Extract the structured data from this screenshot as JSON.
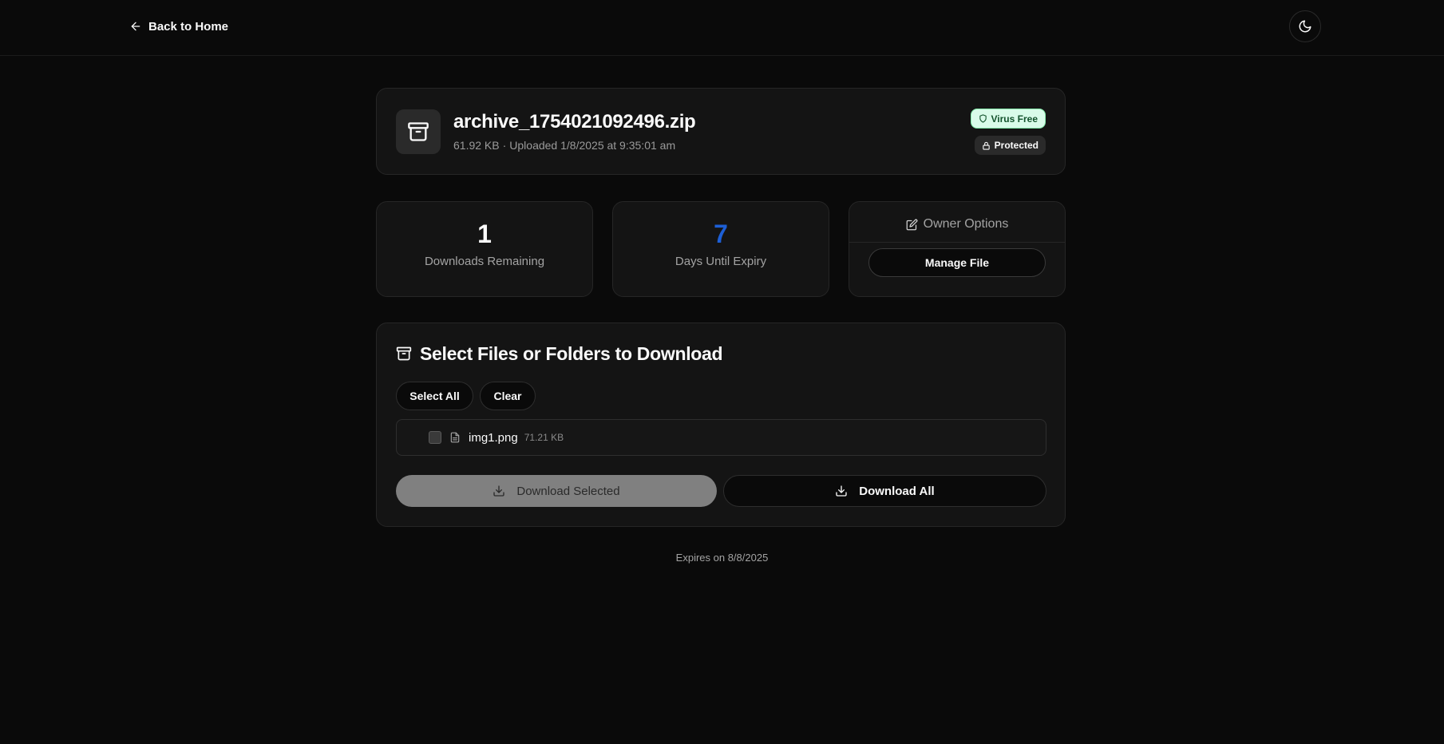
{
  "header": {
    "back_label": "Back to Home",
    "theme_icon": "moon-icon"
  },
  "file": {
    "name": "archive_1754021092496.zip",
    "size": "61.92 KB",
    "separator": "·",
    "uploaded": "Uploaded 1/8/2025 at 9:35:01 am",
    "icon": "archive-icon",
    "badges": {
      "virus_free": "Virus Free",
      "protected": "Protected"
    }
  },
  "stats": {
    "downloads_remaining_value": "1",
    "downloads_remaining_label": "Downloads Remaining",
    "days_until_expiry_value": "7",
    "days_until_expiry_label": "Days Until Expiry",
    "days_color": "#1d5fd6"
  },
  "owner": {
    "title": "Owner Options",
    "manage_label": "Manage File"
  },
  "selection": {
    "title": "Select Files or Folders to Download",
    "select_all_label": "Select All",
    "clear_label": "Clear",
    "files": [
      {
        "name": "img1.png",
        "size": "71.21 KB",
        "checked": false
      }
    ],
    "download_selected_label": "Download Selected",
    "download_all_label": "Download All"
  },
  "footer": {
    "expires_text": "Expires on 8/8/2025"
  }
}
